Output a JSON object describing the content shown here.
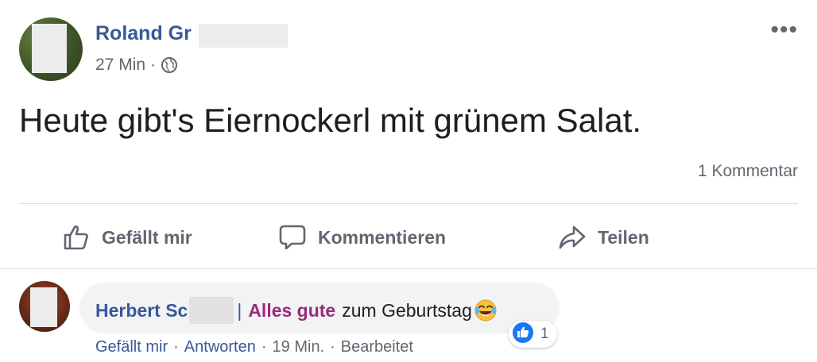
{
  "post": {
    "author": "Roland Gr",
    "time": "27 Min",
    "meta_separator": "·",
    "privacy_icon": "globe-icon",
    "more_icon": "more-options-icon",
    "more_label": "•••",
    "text": "Heute gibt's Eiernockerl mit grünem Salat.",
    "comment_count": "1 Kommentar"
  },
  "actions": {
    "like": {
      "label": "Gefällt mir",
      "icon": "thumbs-up-icon"
    },
    "comment": {
      "label": "Kommentieren",
      "icon": "comment-bubble-icon"
    },
    "share": {
      "label": "Teilen",
      "icon": "share-arrow-icon"
    }
  },
  "comment": {
    "author": "Herbert Sc",
    "separator": "|",
    "tag": "Alles gute",
    "text": "zum Geburtstag",
    "emoji": "tears-of-joy-emoji",
    "reaction_count": "1",
    "reaction_icon": "like-reaction-icon",
    "like_link": "Gefällt mir",
    "reply_link": "Antworten",
    "time": "19 Min.",
    "edited": "Bearbeitet",
    "dot": "·"
  },
  "colors": {
    "link_blue": "#385898",
    "secondary_text": "#606770",
    "tag_purple": "#9a2a7a",
    "bubble_bg": "#f2f3f5",
    "reaction_blue": "#1877f2"
  }
}
